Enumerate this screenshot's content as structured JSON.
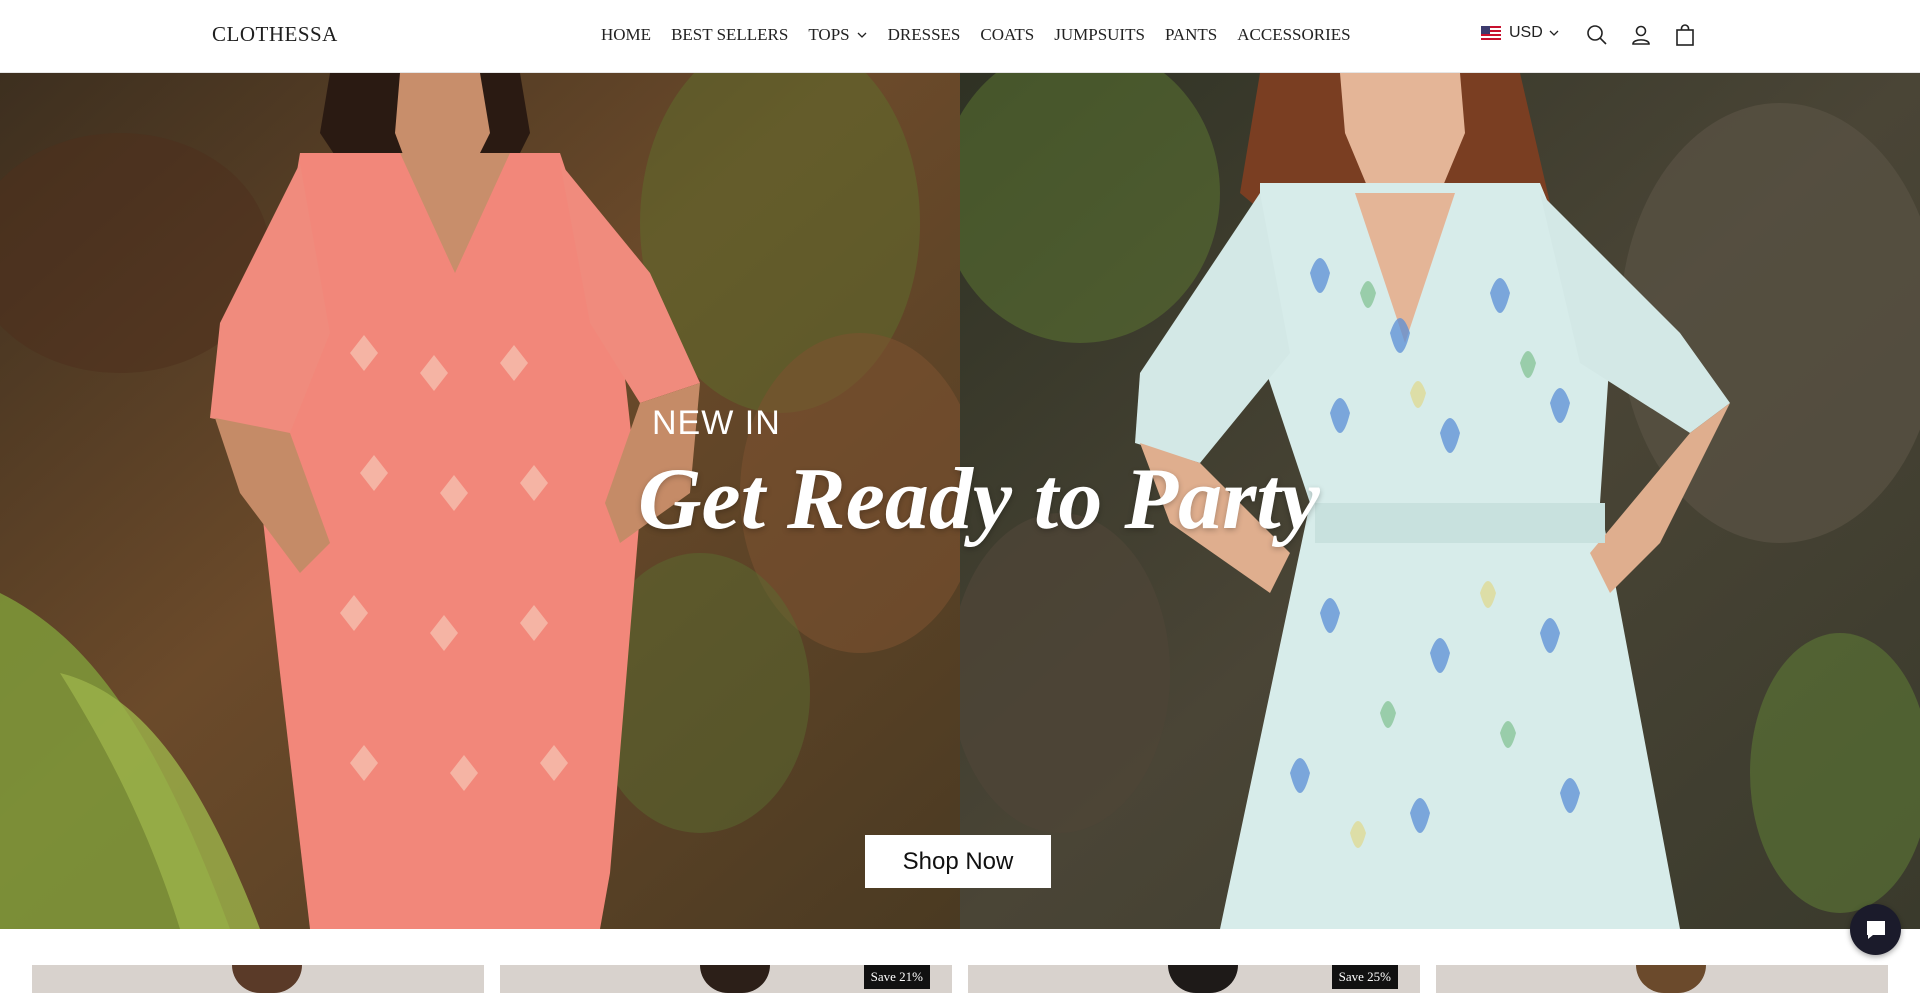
{
  "header": {
    "logo": "CLOTHESSA",
    "nav": [
      {
        "label": "HOME",
        "has_dropdown": false
      },
      {
        "label": "BEST SELLERS",
        "has_dropdown": false
      },
      {
        "label": "TOPS",
        "has_dropdown": true
      },
      {
        "label": "DRESSES",
        "has_dropdown": false
      },
      {
        "label": "COATS",
        "has_dropdown": false
      },
      {
        "label": "JUMPSUITS",
        "has_dropdown": false
      },
      {
        "label": "PANTS",
        "has_dropdown": false
      },
      {
        "label": "ACCESSORIES",
        "has_dropdown": false
      }
    ],
    "currency": {
      "flag": "us-flag-icon",
      "code": "USD"
    },
    "icons": [
      "search-icon",
      "account-icon",
      "cart-icon"
    ]
  },
  "hero": {
    "eyebrow": "NEW IN",
    "headline": "Get Ready to Party",
    "cta_label": "Shop Now",
    "left_dress_color": "#f2877a",
    "right_dress_color": "#d7ecea"
  },
  "products": {
    "badges": [
      "Save 21%",
      "Save 25%"
    ]
  },
  "colors": {
    "header_bg": "#ffffff",
    "text": "#222222",
    "cta_bg": "#ffffff",
    "badge_bg": "#111111",
    "chat_bg": "#1b1b2b"
  },
  "chat": {
    "icon": "chat-bubble-icon"
  }
}
